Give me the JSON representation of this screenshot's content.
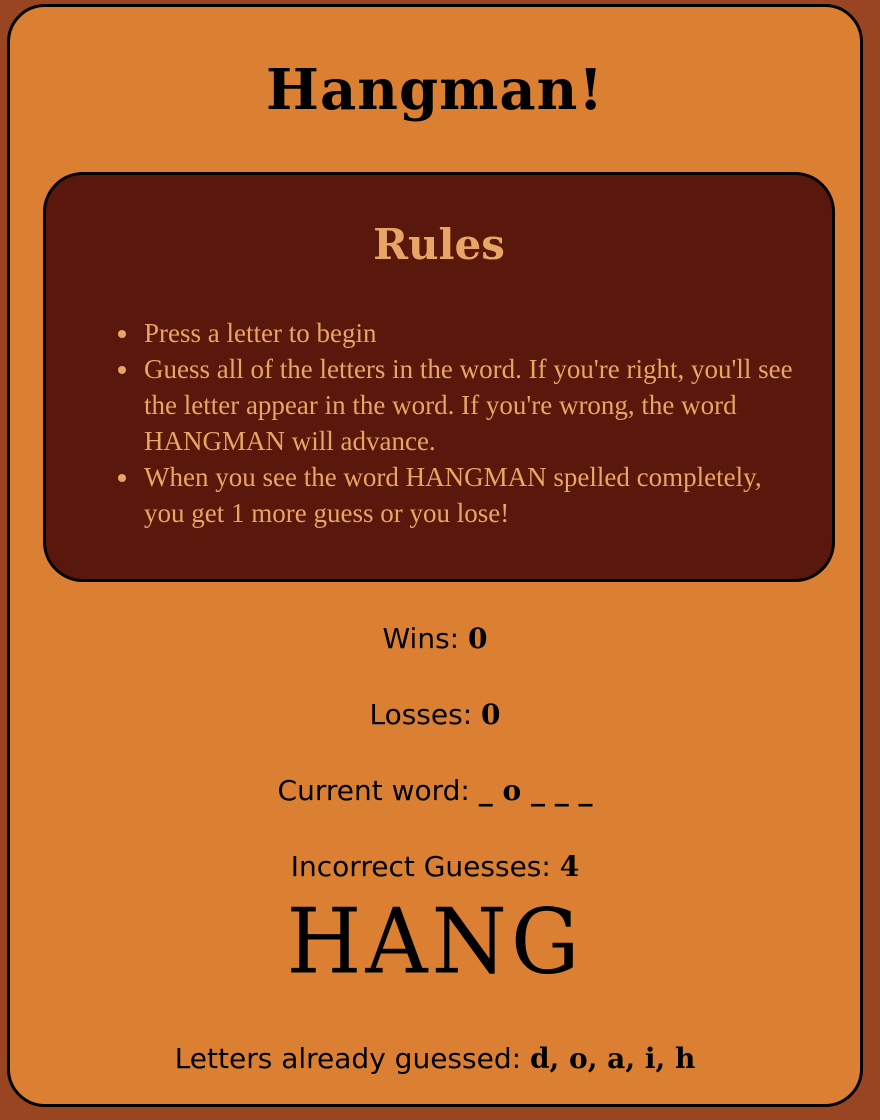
{
  "title": "Hangman!",
  "rules": {
    "heading": "Rules",
    "items": [
      "Press a letter to begin",
      "Guess all of the letters in the word. If you're right, you'll see the letter appear in the word. If you're wrong, the word HANGMAN will advance.",
      "When you see the word HANGMAN spelled completely, you get 1 more guess or you lose!"
    ]
  },
  "stats": {
    "wins_label": "Wins:",
    "wins_value": "0",
    "losses_label": "Losses:",
    "losses_value": "0",
    "current_word_label": "Current word:",
    "current_word_value": "_ o _ _ _",
    "incorrect_label": "Incorrect Guesses:",
    "incorrect_value": "4",
    "guessed_label": "Letters already guessed:",
    "guessed_value": "d, o, a, i, h"
  },
  "hangman_progress": "HANG",
  "colors": {
    "page_background": "#9a4522",
    "card_background": "#db8033",
    "rules_background": "#5a180d",
    "rules_text": "#e8a565"
  }
}
